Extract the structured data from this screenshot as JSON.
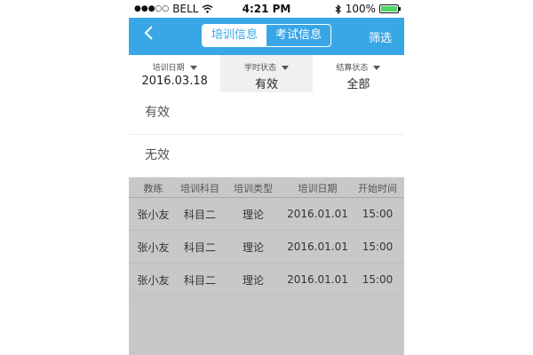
{
  "status_bar": {
    "carrier": "BELL",
    "time": "4:21 PM",
    "battery": "100%",
    "signal_dots": "●●●○○"
  },
  "nav": {
    "back_icon": "chevron-left-icon",
    "tabs": [
      {
        "label": "培训信息"
      },
      {
        "label": "考试信息"
      }
    ],
    "filter_label": "筛选"
  },
  "filters": [
    {
      "label": "培训日期",
      "value": "2016.03.18"
    },
    {
      "label": "学时状态",
      "value": "有效"
    },
    {
      "label": "结算状态",
      "value": "全部"
    }
  ],
  "dropdown_options": [
    {
      "label": "有效"
    },
    {
      "label": "无效"
    }
  ],
  "table": {
    "headers": [
      "教练",
      "培训科目",
      "培训类型",
      "培训日期",
      "开始时间"
    ],
    "rows": [
      [
        "张小友",
        "科目二",
        "理论",
        "2016.01.01",
        "15:00"
      ],
      [
        "张小友",
        "科目二",
        "理论",
        "2016.01.01",
        "15:00"
      ],
      [
        "张小友",
        "科目二",
        "理论",
        "2016.01.01",
        "15:00"
      ]
    ]
  },
  "colors": {
    "accent": "#39a6e6",
    "battery": "#4cd964",
    "overlay": "#c8c8c8"
  }
}
